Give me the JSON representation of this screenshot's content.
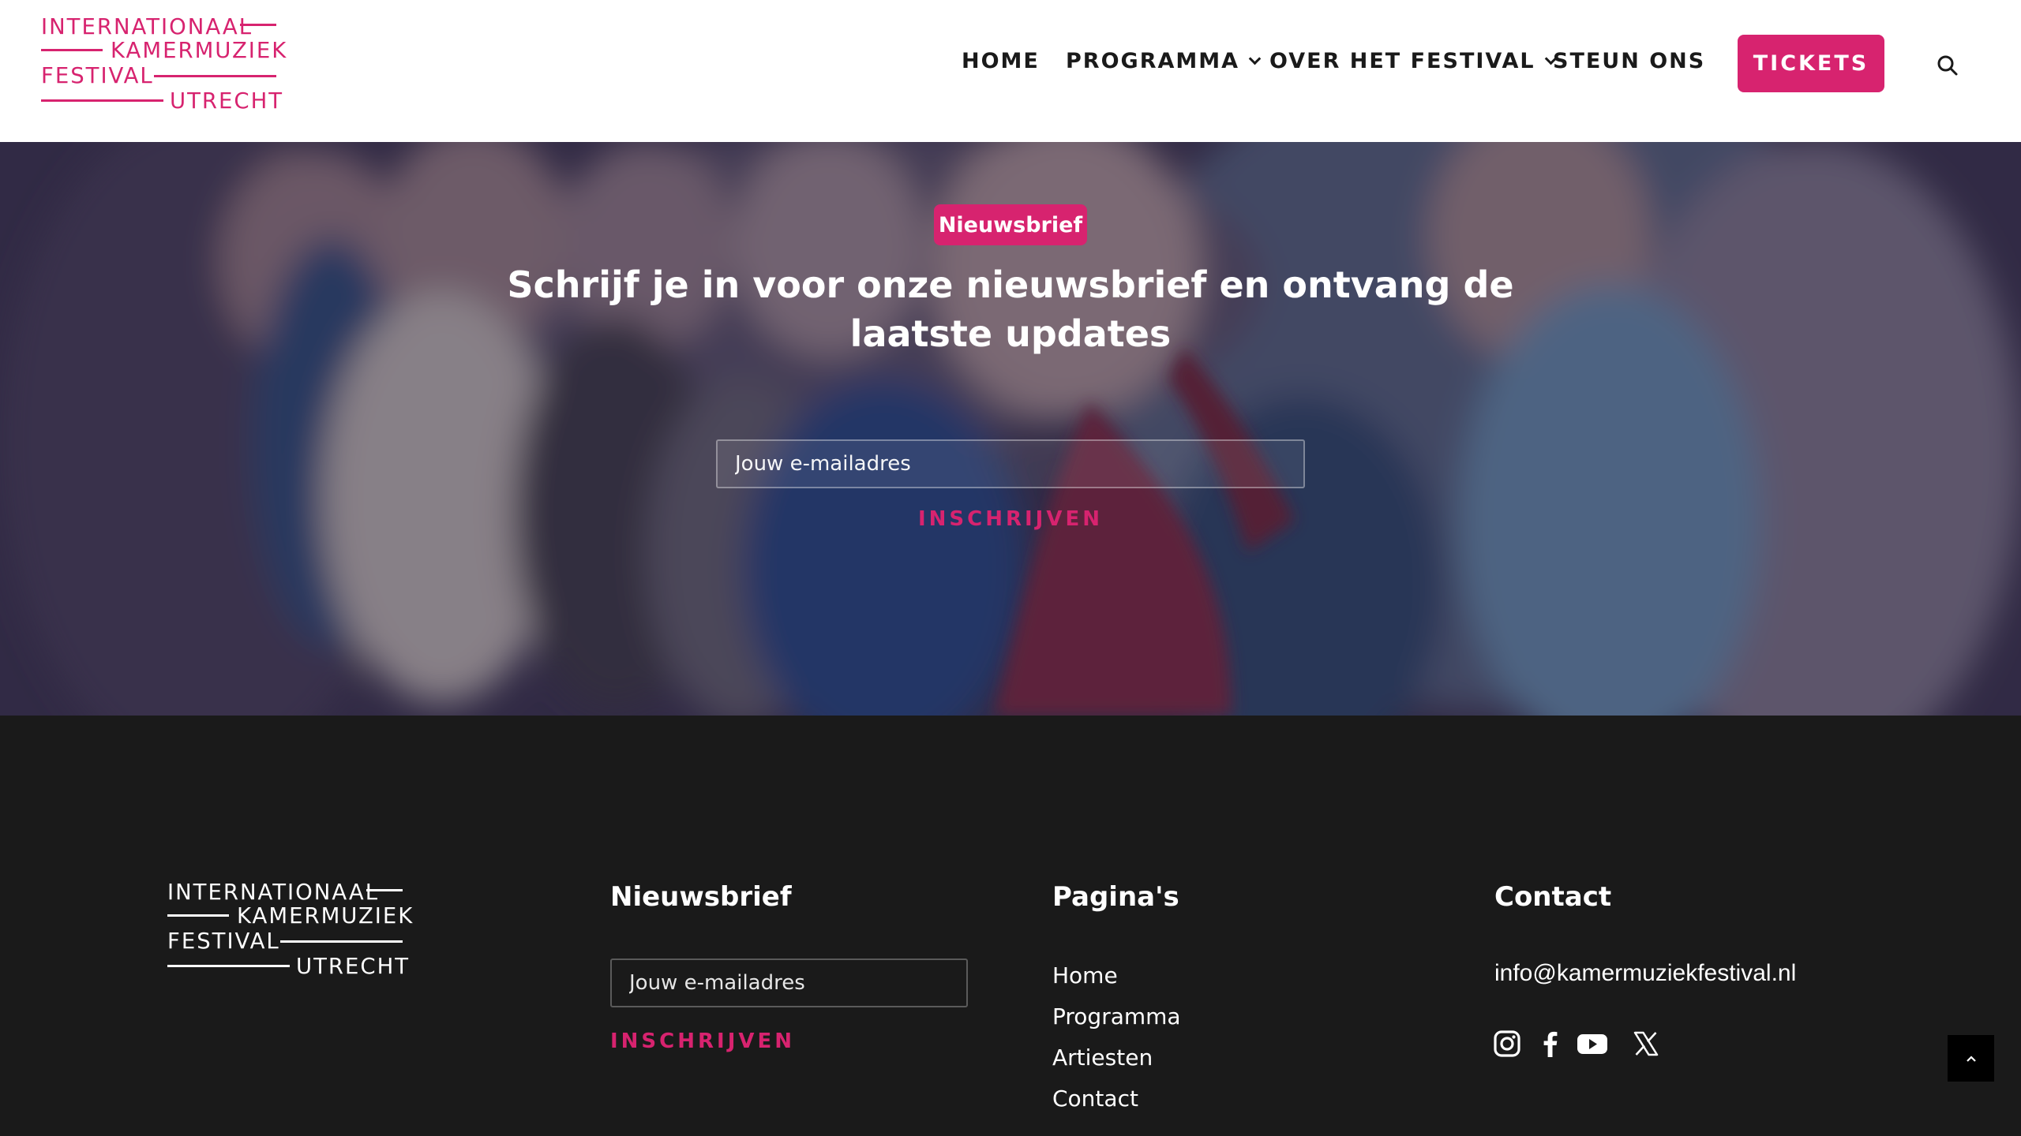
{
  "header": {
    "logo": {
      "line1": "INTERNATIONAAL",
      "line2": "KAMERMUZIEK",
      "line3": "FESTIVAL",
      "line4": "UTRECHT"
    },
    "nav": {
      "home": "HOME",
      "programma": "PROGRAMMA",
      "over": "OVER HET FESTIVAL",
      "steun": "STEUN ONS"
    },
    "tickets_label": "TICKETS",
    "icons": {
      "search": "search-icon",
      "dropdown": "chevron-down-icon"
    }
  },
  "hero": {
    "badge": "Nieuwsbrief",
    "title": "Schrijf je in voor onze nieuwsbrief en ontvang de laatste updates",
    "email_placeholder": "Jouw e-mailadres",
    "submit_label": "INSCHRIJVEN"
  },
  "footer": {
    "logo": {
      "line1": "INTERNATIONAAL",
      "line2": "KAMERMUZIEK",
      "line3": "FESTIVAL",
      "line4": "UTRECHT"
    },
    "newsletter": {
      "title": "Nieuwsbrief",
      "email_placeholder": "Jouw e-mailadres",
      "submit_label": "INSCHRIJVEN"
    },
    "pages": {
      "title": "Pagina's",
      "links": [
        "Home",
        "Programma",
        "Artiesten",
        "Contact"
      ]
    },
    "contact": {
      "title": "Contact",
      "email": "info@kamermuziekfestival.nl",
      "social_icons": [
        "instagram-icon",
        "facebook-icon",
        "youtube-icon",
        "x-icon"
      ]
    },
    "scroll_top_icon": "chevron-up-icon"
  },
  "colors": {
    "brand": "#d7236f",
    "header_bg": "#ffffff",
    "footer_bg": "#1a1a1a",
    "text_dark": "#1a1a1a"
  }
}
